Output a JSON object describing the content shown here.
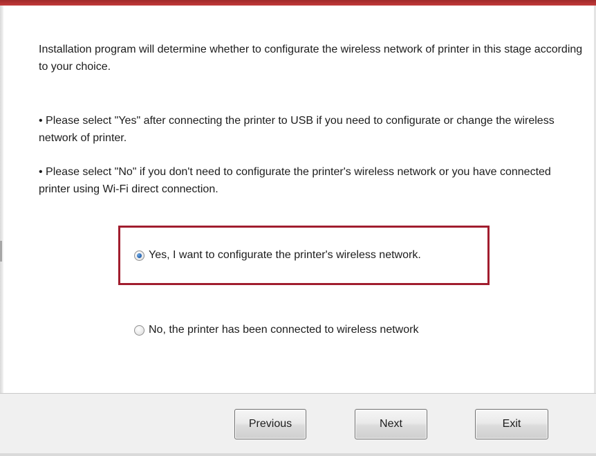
{
  "dialog": {
    "intro": "Installation program will determine whether to configurate the wireless network of printer in this stage according to your choice.",
    "bullet_yes": "• Please select \"Yes\" after connecting the printer to USB if you need to configurate or change the wireless network of printer.",
    "bullet_no": "• Please select \"No\" if you don't need to configurate the printer's wireless network or you have connected printer using Wi-Fi direct connection."
  },
  "options": [
    {
      "label": "Yes, I want to configurate the printer's wireless network.",
      "selected": true
    },
    {
      "label": "No, the printer has been connected to wireless network",
      "selected": false
    }
  ],
  "buttons": {
    "previous": "Previous",
    "next": "Next",
    "exit": "Exit"
  },
  "colors": {
    "highlight_border": "#a11d2e",
    "top_accent": "#b83232",
    "footer_background": "#f0f0f0"
  }
}
